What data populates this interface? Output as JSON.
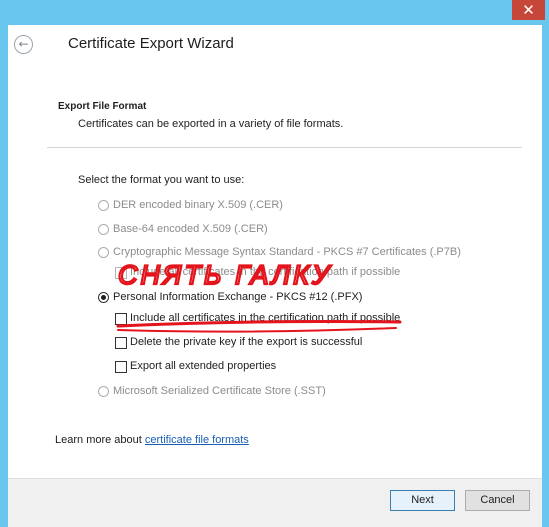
{
  "window": {
    "close_glyph": "✕",
    "title": "Certificate Export Wizard",
    "back_glyph": "←"
  },
  "page": {
    "section_title": "Export File Format",
    "section_desc": "Certificates can be exported in a variety of file formats.",
    "prompt": "Select the format you want to use:"
  },
  "options": {
    "der": "DER encoded binary X.509 (.CER)",
    "base64": "Base-64 encoded X.509 (.CER)",
    "pkcs7": "Cryptographic Message Syntax Standard - PKCS #7 Certificates (.P7B)",
    "pkcs7_include": "Include all certificates in the certification path if possible",
    "pfx": "Personal Information Exchange - PKCS #12 (.PFX)",
    "pfx_include": "Include all certificates in the certification path if possible",
    "pfx_delete_key": "Delete the private key if the export is successful",
    "pfx_extended": "Export all extended properties",
    "sst": "Microsoft Serialized Certificate Store (.SST)"
  },
  "learn_more": {
    "prefix": "Learn more about ",
    "link": "certificate file formats"
  },
  "buttons": {
    "next": "Next",
    "cancel": "Cancel"
  },
  "annotation": {
    "text": "СНЯТЬ ГАЛКУ",
    "color": "#e3141c"
  },
  "colors": {
    "frame": "#69c6ee",
    "close": "#c7463a",
    "link": "#1a5fb4"
  }
}
